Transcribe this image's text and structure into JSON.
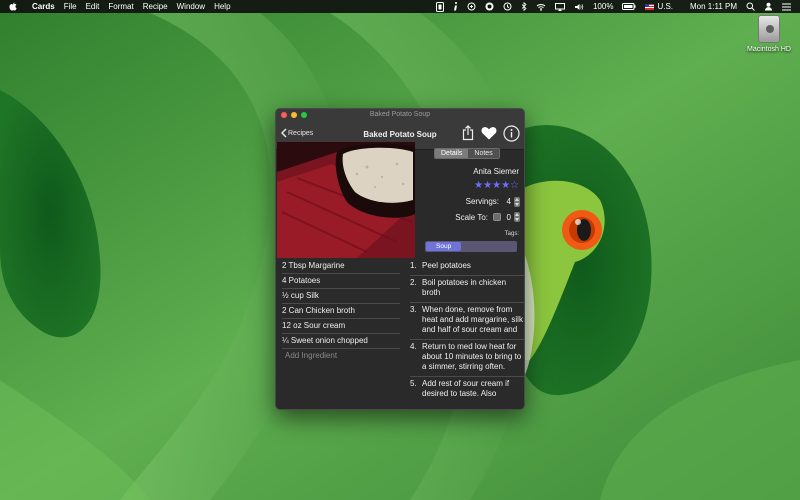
{
  "menubar": {
    "app_name": "Cards",
    "menus": [
      "File",
      "Edit",
      "Format",
      "Recipe",
      "Window",
      "Help"
    ],
    "battery": "100%",
    "input_source": "U.S.",
    "clock": "Mon 1:11 PM"
  },
  "desktop": {
    "hd_label": "Macintosh HD"
  },
  "window": {
    "title": "Baked Potato Soup",
    "back_label": "Recipes",
    "recipe_title": "Baked Potato Soup",
    "tabs": {
      "details": "Details",
      "notes": "Notes"
    },
    "author": "Anita Siemer",
    "rating": 4,
    "rating_max": 5,
    "servings_label": "Servings:",
    "servings_value": "4",
    "scale_label": "Scale To:",
    "scale_value": "0",
    "tags_label": "Tags:",
    "tag": "Soup",
    "ingredients": [
      "2 Tbsp Margarine",
      "4 Potatoes",
      "½ cup Silk",
      "2 Can Chicken broth",
      "12 oz Sour cream",
      "¼ Sweet onion chopped"
    ],
    "add_ingredient_placeholder": "Add Ingredient",
    "steps": [
      {
        "num": "1.",
        "text": "Peel potatoes"
      },
      {
        "num": "2.",
        "text": "Boil potatoes in chicken broth"
      },
      {
        "num": "3.",
        "text": "When done, remove from heat and add margarine, silk and half of sour cream and"
      },
      {
        "num": "4.",
        "text": "Return to med low heat for about 10 minutes to bring to a simmer, stirring often."
      },
      {
        "num": "5.",
        "text": "Add rest of sour cream if desired to taste. Also"
      }
    ]
  },
  "colors": {
    "star": "#6f6cff",
    "tag_chip": "#6e74d8"
  }
}
